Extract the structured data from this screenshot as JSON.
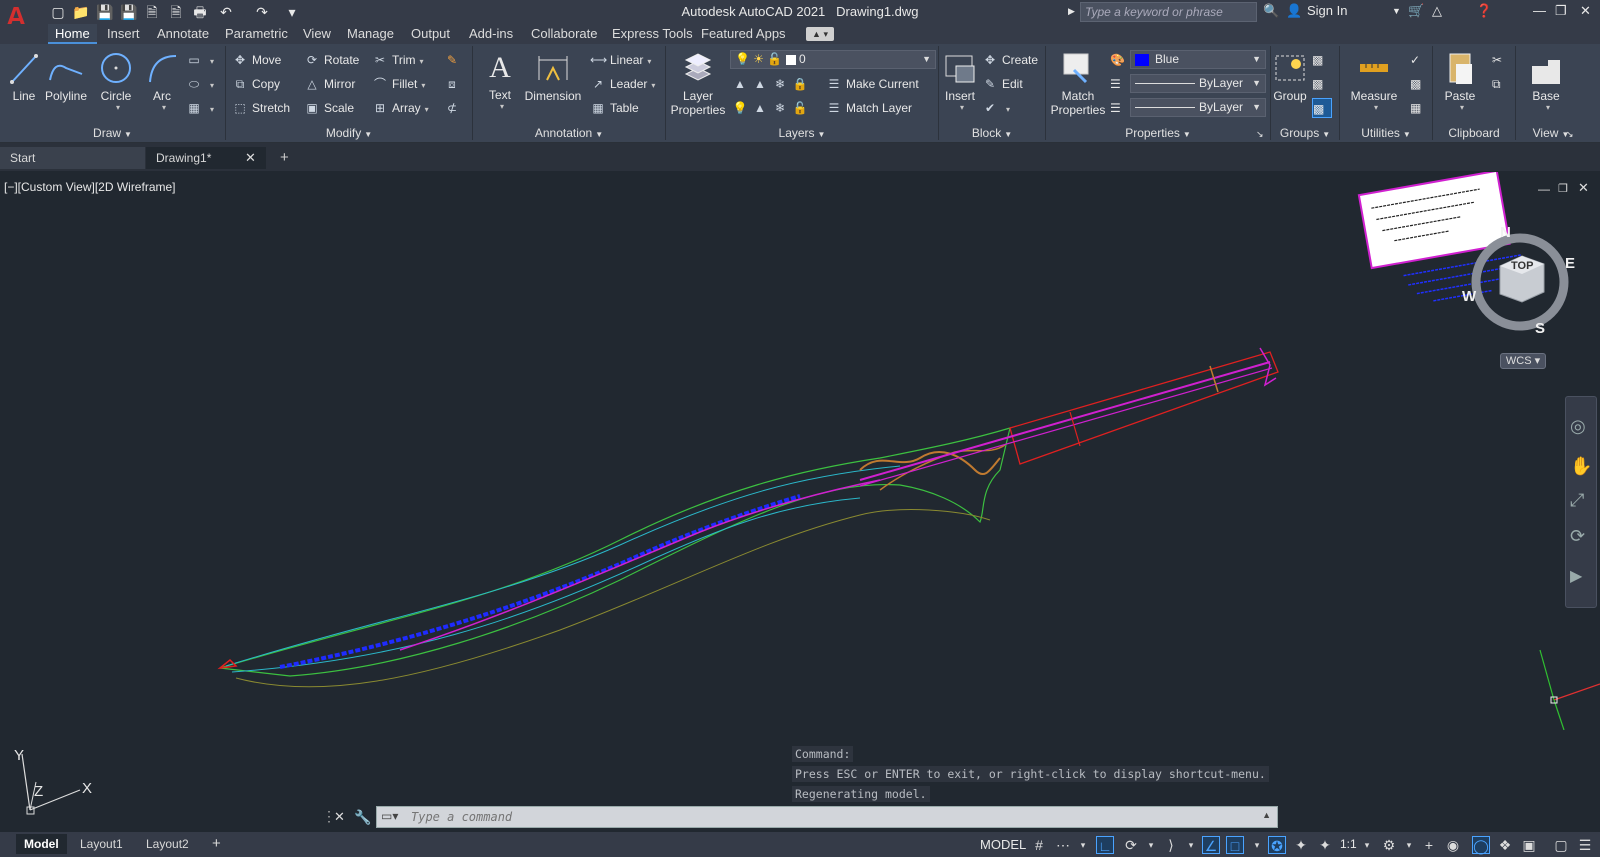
{
  "titlebar": {
    "app_name": "Autodesk AutoCAD 2021",
    "document": "Drawing1.dwg",
    "search_placeholder": "Type a keyword or phrase",
    "sign_in": "Sign In"
  },
  "ribbon_tabs": [
    "Home",
    "Insert",
    "Annotate",
    "Parametric",
    "View",
    "Manage",
    "Output",
    "Add-ins",
    "Collaborate",
    "Express Tools",
    "Featured Apps"
  ],
  "panels": {
    "draw": {
      "title": "Draw",
      "line": "Line",
      "polyline": "Polyline",
      "circle": "Circle",
      "arc": "Arc"
    },
    "modify": {
      "title": "Modify",
      "move": "Move",
      "rotate": "Rotate",
      "trim": "Trim",
      "copy": "Copy",
      "mirror": "Mirror",
      "fillet": "Fillet",
      "stretch": "Stretch",
      "scale": "Scale",
      "array": "Array"
    },
    "annotation": {
      "title": "Annotation",
      "text": "Text",
      "dimension": "Dimension",
      "linear": "Linear",
      "leader": "Leader",
      "table": "Table"
    },
    "layers": {
      "title": "Layers",
      "layer_properties_1": "Layer",
      "layer_properties_2": "Properties",
      "current_layer": "0",
      "make_current": "Make Current",
      "match_layer": "Match Layer"
    },
    "block": {
      "title": "Block",
      "insert": "Insert",
      "create": "Create",
      "edit": "Edit"
    },
    "properties": {
      "title": "Properties",
      "match_1": "Match",
      "match_2": "Properties",
      "color": "Blue",
      "linetype": "ByLayer",
      "lineweight": "ByLayer"
    },
    "groups": {
      "title": "Groups",
      "group": "Group"
    },
    "utilities": {
      "title": "Utilities",
      "measure": "Measure"
    },
    "clipboard": {
      "title": "Clipboard",
      "paste": "Paste"
    },
    "view": {
      "title": "View",
      "base": "Base"
    }
  },
  "doc_tabs": {
    "start": "Start",
    "drawing": "Drawing1*"
  },
  "viewport": {
    "label": "[−][Custom View][2D Wireframe]"
  },
  "viewcube": {
    "top": "TOP",
    "n": "N",
    "e": "E",
    "s": "S",
    "w": "W",
    "wcs": "WCS"
  },
  "ucs": {
    "x": "X",
    "y": "Y",
    "z": "Z"
  },
  "command": {
    "history": [
      "Command:",
      "Press ESC or ENTER to exit, or right-click to display shortcut-menu.",
      "Regenerating model."
    ],
    "placeholder": "Type a command"
  },
  "status": {
    "layouts": [
      "Model",
      "Layout1",
      "Layout2"
    ],
    "mode": "MODEL",
    "scale": "1:1"
  },
  "colors": {
    "accent": "#4a90d9",
    "canvas": "#212830",
    "ribbon": "#3b4453",
    "blue_swatch": "#0000ff"
  }
}
